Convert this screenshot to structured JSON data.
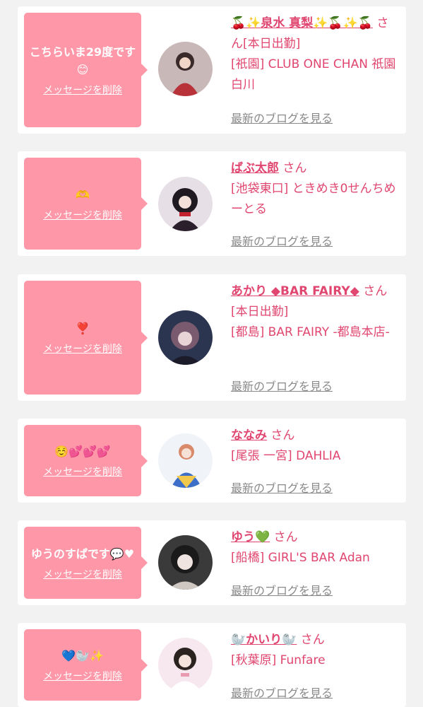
{
  "delete_label": "メッセージを削除",
  "blog_label": "最新のブログを見る",
  "accent_color": "#e0466f",
  "bubble_color": "#fe97a8",
  "cards": [
    {
      "message": "こちらいま29度です😊",
      "name": "🍒✨泉水 真梨✨🍒✨🍒",
      "suffix": "さん[本日出勤]",
      "shop": "[祇園] CLUB ONE CHAN 祇園白川"
    },
    {
      "message": "🫶",
      "name": "ばぶ太郎",
      "suffix": "さん",
      "shop": "[池袋東口] ときめき0せんちめーとる"
    },
    {
      "message": "❣️",
      "name": "あかり ◆BAR FAIRY◆",
      "suffix": "さん[本日出勤]",
      "shop": "[都島] BAR FAIRY -都島本店-"
    },
    {
      "message": "☺️💕💕💕",
      "name": "ななみ",
      "suffix": "さん",
      "shop": "[尾張 一宮] DAHLIA"
    },
    {
      "message": "ゆうのすぱです💬♥",
      "name": "ゆう💚",
      "suffix": "さん",
      "shop": "[船橋] GIRL'S BAR Adan"
    },
    {
      "message": "💙🦭✨",
      "name": "🦭かいり🦭",
      "suffix": "さん",
      "shop": "[秋葉原] Funfare"
    }
  ]
}
